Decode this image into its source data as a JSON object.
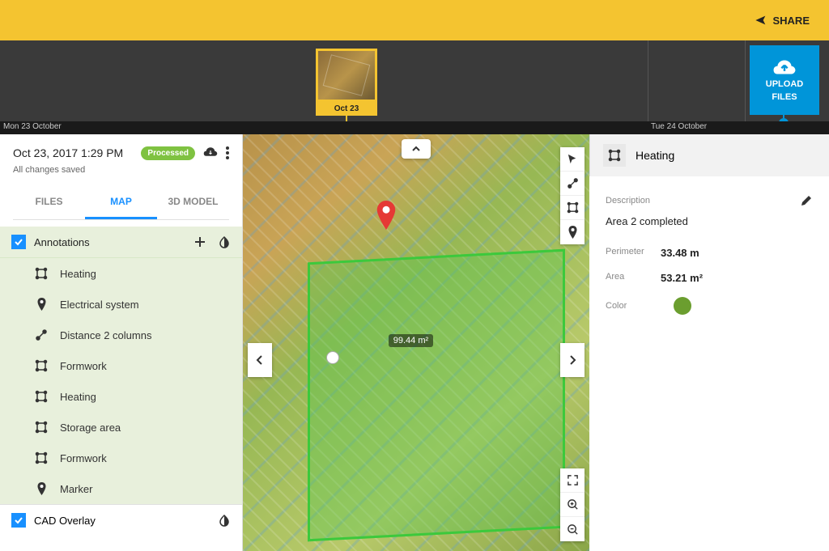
{
  "topbar": {
    "share": "SHARE"
  },
  "timeline": {
    "thumb_caption": "Oct 23",
    "upload_line1": "UPLOAD",
    "upload_line2": "FILES",
    "date_left": "Mon 23 October",
    "date_right": "Tue 24 October"
  },
  "sidebar": {
    "datetime": "Oct 23, 2017 1:29 PM",
    "status_badge": "Processed",
    "save_status": "All changes saved",
    "tabs": {
      "files": "FILES",
      "map": "MAP",
      "model": "3D MODEL"
    },
    "annotations_header": "Annotations",
    "annotations": [
      {
        "icon": "polygon",
        "label": "Heating"
      },
      {
        "icon": "pin",
        "label": "Electrical system"
      },
      {
        "icon": "line",
        "label": "Distance 2 columns"
      },
      {
        "icon": "polygon",
        "label": "Formwork"
      },
      {
        "icon": "polygon",
        "label": "Heating"
      },
      {
        "icon": "polygon",
        "label": "Storage area"
      },
      {
        "icon": "polygon",
        "label": "Formwork"
      },
      {
        "icon": "pin",
        "label": "Marker"
      }
    ],
    "cad_header": "CAD Overlay"
  },
  "map": {
    "area_label": "99.44 m²"
  },
  "detail": {
    "title": "Heating",
    "desc_label": "Description",
    "desc_value": "Area 2 completed",
    "perimeter_label": "Perimeter",
    "perimeter_value": "33.48 m",
    "area_label": "Area",
    "area_value": "53.21 m²",
    "color_label": "Color",
    "color_value": "#6b9e2f"
  }
}
